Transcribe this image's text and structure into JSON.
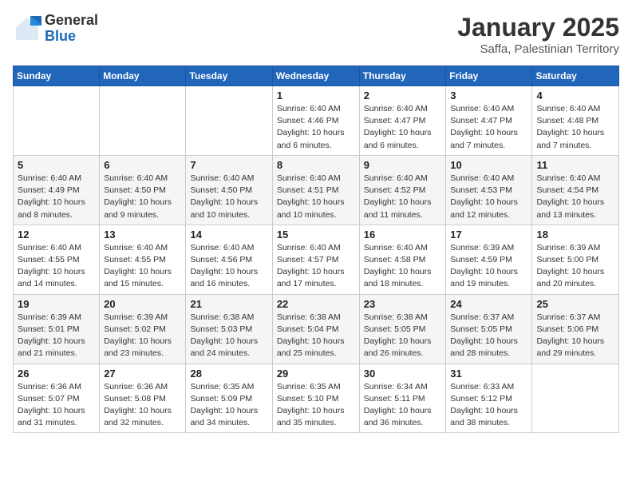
{
  "logo": {
    "general": "General",
    "blue": "Blue"
  },
  "title": "January 2025",
  "location": "Saffa, Palestinian Territory",
  "weekdays": [
    "Sunday",
    "Monday",
    "Tuesday",
    "Wednesday",
    "Thursday",
    "Friday",
    "Saturday"
  ],
  "weeks": [
    [
      {
        "day": "",
        "info": ""
      },
      {
        "day": "",
        "info": ""
      },
      {
        "day": "",
        "info": ""
      },
      {
        "day": "1",
        "info": "Sunrise: 6:40 AM\nSunset: 4:46 PM\nDaylight: 10 hours and 6 minutes."
      },
      {
        "day": "2",
        "info": "Sunrise: 6:40 AM\nSunset: 4:47 PM\nDaylight: 10 hours and 6 minutes."
      },
      {
        "day": "3",
        "info": "Sunrise: 6:40 AM\nSunset: 4:47 PM\nDaylight: 10 hours and 7 minutes."
      },
      {
        "day": "4",
        "info": "Sunrise: 6:40 AM\nSunset: 4:48 PM\nDaylight: 10 hours and 7 minutes."
      }
    ],
    [
      {
        "day": "5",
        "info": "Sunrise: 6:40 AM\nSunset: 4:49 PM\nDaylight: 10 hours and 8 minutes."
      },
      {
        "day": "6",
        "info": "Sunrise: 6:40 AM\nSunset: 4:50 PM\nDaylight: 10 hours and 9 minutes."
      },
      {
        "day": "7",
        "info": "Sunrise: 6:40 AM\nSunset: 4:50 PM\nDaylight: 10 hours and 10 minutes."
      },
      {
        "day": "8",
        "info": "Sunrise: 6:40 AM\nSunset: 4:51 PM\nDaylight: 10 hours and 10 minutes."
      },
      {
        "day": "9",
        "info": "Sunrise: 6:40 AM\nSunset: 4:52 PM\nDaylight: 10 hours and 11 minutes."
      },
      {
        "day": "10",
        "info": "Sunrise: 6:40 AM\nSunset: 4:53 PM\nDaylight: 10 hours and 12 minutes."
      },
      {
        "day": "11",
        "info": "Sunrise: 6:40 AM\nSunset: 4:54 PM\nDaylight: 10 hours and 13 minutes."
      }
    ],
    [
      {
        "day": "12",
        "info": "Sunrise: 6:40 AM\nSunset: 4:55 PM\nDaylight: 10 hours and 14 minutes."
      },
      {
        "day": "13",
        "info": "Sunrise: 6:40 AM\nSunset: 4:55 PM\nDaylight: 10 hours and 15 minutes."
      },
      {
        "day": "14",
        "info": "Sunrise: 6:40 AM\nSunset: 4:56 PM\nDaylight: 10 hours and 16 minutes."
      },
      {
        "day": "15",
        "info": "Sunrise: 6:40 AM\nSunset: 4:57 PM\nDaylight: 10 hours and 17 minutes."
      },
      {
        "day": "16",
        "info": "Sunrise: 6:40 AM\nSunset: 4:58 PM\nDaylight: 10 hours and 18 minutes."
      },
      {
        "day": "17",
        "info": "Sunrise: 6:39 AM\nSunset: 4:59 PM\nDaylight: 10 hours and 19 minutes."
      },
      {
        "day": "18",
        "info": "Sunrise: 6:39 AM\nSunset: 5:00 PM\nDaylight: 10 hours and 20 minutes."
      }
    ],
    [
      {
        "day": "19",
        "info": "Sunrise: 6:39 AM\nSunset: 5:01 PM\nDaylight: 10 hours and 21 minutes."
      },
      {
        "day": "20",
        "info": "Sunrise: 6:39 AM\nSunset: 5:02 PM\nDaylight: 10 hours and 23 minutes."
      },
      {
        "day": "21",
        "info": "Sunrise: 6:38 AM\nSunset: 5:03 PM\nDaylight: 10 hours and 24 minutes."
      },
      {
        "day": "22",
        "info": "Sunrise: 6:38 AM\nSunset: 5:04 PM\nDaylight: 10 hours and 25 minutes."
      },
      {
        "day": "23",
        "info": "Sunrise: 6:38 AM\nSunset: 5:05 PM\nDaylight: 10 hours and 26 minutes."
      },
      {
        "day": "24",
        "info": "Sunrise: 6:37 AM\nSunset: 5:05 PM\nDaylight: 10 hours and 28 minutes."
      },
      {
        "day": "25",
        "info": "Sunrise: 6:37 AM\nSunset: 5:06 PM\nDaylight: 10 hours and 29 minutes."
      }
    ],
    [
      {
        "day": "26",
        "info": "Sunrise: 6:36 AM\nSunset: 5:07 PM\nDaylight: 10 hours and 31 minutes."
      },
      {
        "day": "27",
        "info": "Sunrise: 6:36 AM\nSunset: 5:08 PM\nDaylight: 10 hours and 32 minutes."
      },
      {
        "day": "28",
        "info": "Sunrise: 6:35 AM\nSunset: 5:09 PM\nDaylight: 10 hours and 34 minutes."
      },
      {
        "day": "29",
        "info": "Sunrise: 6:35 AM\nSunset: 5:10 PM\nDaylight: 10 hours and 35 minutes."
      },
      {
        "day": "30",
        "info": "Sunrise: 6:34 AM\nSunset: 5:11 PM\nDaylight: 10 hours and 36 minutes."
      },
      {
        "day": "31",
        "info": "Sunrise: 6:33 AM\nSunset: 5:12 PM\nDaylight: 10 hours and 38 minutes."
      },
      {
        "day": "",
        "info": ""
      }
    ]
  ]
}
